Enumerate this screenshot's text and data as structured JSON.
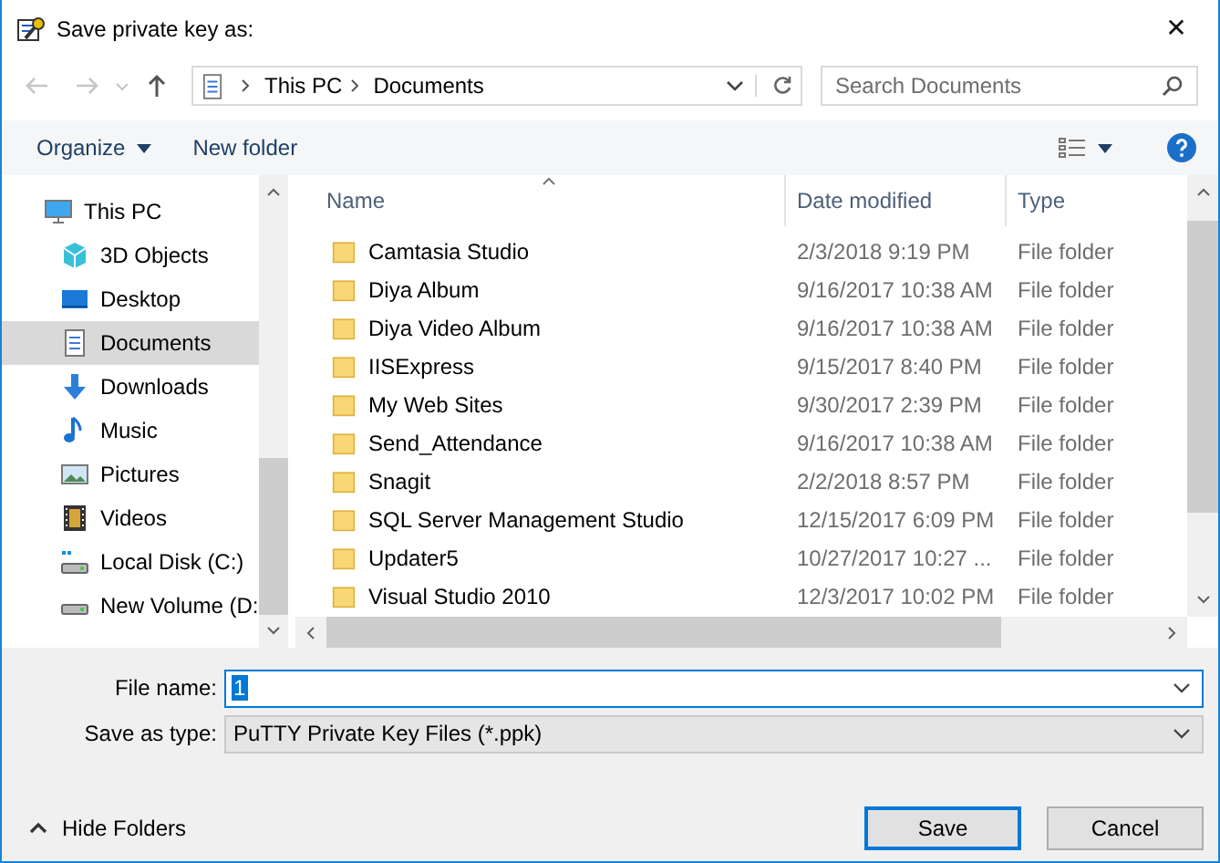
{
  "window": {
    "title": "Save private key as:",
    "close": "✕"
  },
  "address": {
    "crumbs": [
      "This PC",
      "Documents"
    ]
  },
  "search": {
    "placeholder": "Search Documents"
  },
  "toolbar": {
    "organize": "Organize",
    "new_folder": "New folder"
  },
  "sidebar": {
    "items": [
      {
        "label": "This PC",
        "kind": "pc",
        "selected": false
      },
      {
        "label": "3D Objects",
        "kind": "objects",
        "selected": false
      },
      {
        "label": "Desktop",
        "kind": "desktop",
        "selected": false
      },
      {
        "label": "Documents",
        "kind": "documents",
        "selected": true
      },
      {
        "label": "Downloads",
        "kind": "downloads",
        "selected": false
      },
      {
        "label": "Music",
        "kind": "music",
        "selected": false
      },
      {
        "label": "Pictures",
        "kind": "pictures",
        "selected": false
      },
      {
        "label": "Videos",
        "kind": "videos",
        "selected": false
      },
      {
        "label": "Local Disk (C:)",
        "kind": "system-drive",
        "selected": false
      },
      {
        "label": "New Volume (D:",
        "kind": "drive",
        "selected": false
      }
    ]
  },
  "table": {
    "columns": [
      "Name",
      "Date modified",
      "Type"
    ],
    "rows": [
      {
        "name": "Camtasia Studio",
        "date": "2/3/2018 9:19 PM",
        "type": "File folder"
      },
      {
        "name": "Diya Album",
        "date": "9/16/2017 10:38 AM",
        "type": "File folder"
      },
      {
        "name": "Diya Video Album",
        "date": "9/16/2017 10:38 AM",
        "type": "File folder"
      },
      {
        "name": "IISExpress",
        "date": "9/15/2017 8:40 PM",
        "type": "File folder"
      },
      {
        "name": "My Web Sites",
        "date": "9/30/2017 2:39 PM",
        "type": "File folder"
      },
      {
        "name": "Send_Attendance",
        "date": "9/16/2017 10:38 AM",
        "type": "File folder"
      },
      {
        "name": "Snagit",
        "date": "2/2/2018 8:57 PM",
        "type": "File folder"
      },
      {
        "name": "SQL Server Management Studio",
        "date": "12/15/2017 6:09 PM",
        "type": "File folder"
      },
      {
        "name": "Updater5",
        "date": "10/27/2017 10:27 ...",
        "type": "File folder"
      },
      {
        "name": "Visual Studio 2010",
        "date": "12/3/2017 10:02 PM",
        "type": "File folder"
      }
    ]
  },
  "form": {
    "file_name_label": "File name:",
    "file_name": "1",
    "file_name_highlighted": true,
    "type_label": "Save as type:",
    "type_value": "PuTTY Private Key Files (*.ppk)"
  },
  "footer": {
    "hide_folders": "Hide Folders",
    "save": "Save",
    "cancel": "Cancel"
  }
}
